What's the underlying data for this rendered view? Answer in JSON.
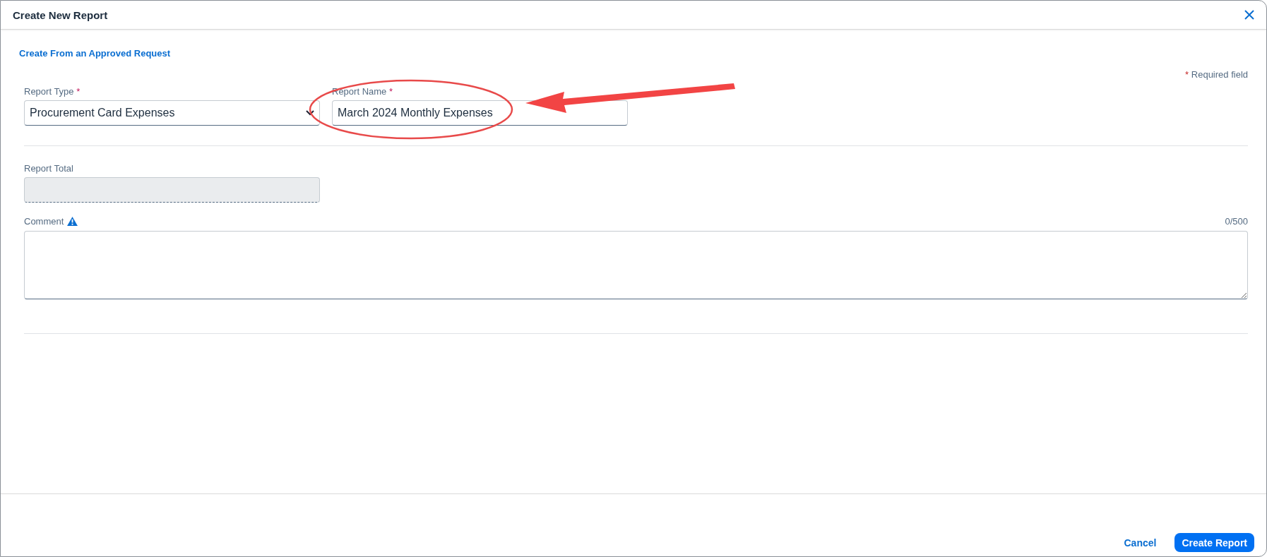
{
  "window": {
    "title": "Create New Report"
  },
  "link": "Create From an Approved Request",
  "required_note": {
    "mark": "*",
    "text": "Required field"
  },
  "top_fields": [
    {
      "kind": "select",
      "label": "Report Type",
      "required_mark": "*",
      "value": "Procurement Card Expenses"
    },
    {
      "kind": "text",
      "label": "Report Name",
      "required_mark": "*",
      "value": "March 2024 Monthly Expenses"
    }
  ],
  "report_total": {
    "label": "Report Total",
    "disabled": true
  },
  "comment": {
    "label": "Comment",
    "counter": "0/500"
  },
  "buttons": [
    {
      "kind": "link",
      "label": "Cancel"
    },
    {
      "kind": "primary",
      "label": "Create Report"
    }
  ]
}
